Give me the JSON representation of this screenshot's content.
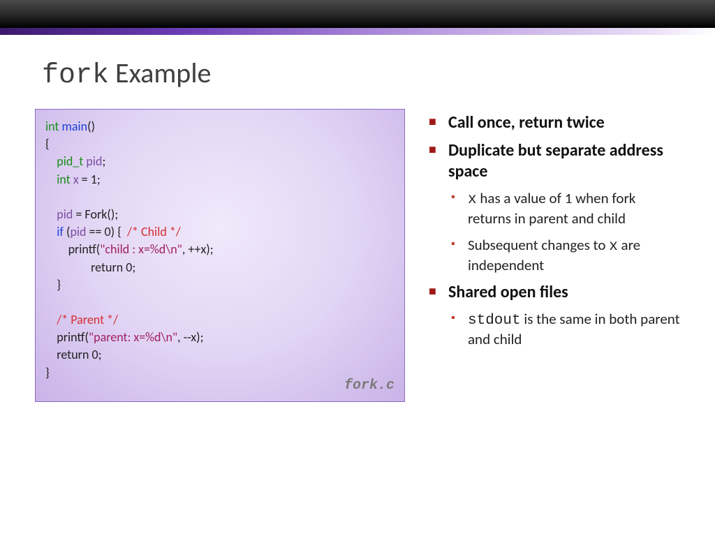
{
  "title_mono": "fork",
  "title_rest": " Example",
  "code": {
    "l1_type": "int ",
    "l1_func": "main",
    "l1_rest": "()",
    "l2": "{",
    "l3_type": "pid_t ",
    "l3_var": "pid",
    "l3_rest": ";",
    "l4_type": "int ",
    "l4_var": "x",
    "l4_rest": " = 1;",
    "l5_var": "pid",
    "l5_rest": " = Fork();",
    "l6_ctrl": "if",
    "l6_a": " (",
    "l6_var": "pid",
    "l6_b": " == 0) {  ",
    "l6_cmt": "/* Child */",
    "l7_a": "printf(",
    "l7_str": "\"child : x=%d\\n\"",
    "l7_b": ", ++x);",
    "l8": "return 0;",
    "l9": "}",
    "l10_cmt": "/* Parent */",
    "l11_a": "printf(",
    "l11_str": "\"parent: x=%d\\n\"",
    "l11_b": ", --x);",
    "l12": "return 0;",
    "l13": "}",
    "filename": "fork.c"
  },
  "bullets": {
    "b1": "Call once, return twice",
    "b2": "Duplicate but separate address space",
    "b2_1_mono": "x",
    "b2_1_rest": " has a value of 1 when fork returns in parent and child",
    "b2_2_a": "Subsequent changes to ",
    "b2_2_mono": "x",
    "b2_2_b": " are independent",
    "b3": "Shared open files",
    "b3_1_mono": "stdout",
    "b3_1_rest": " is the same in both parent and child"
  }
}
